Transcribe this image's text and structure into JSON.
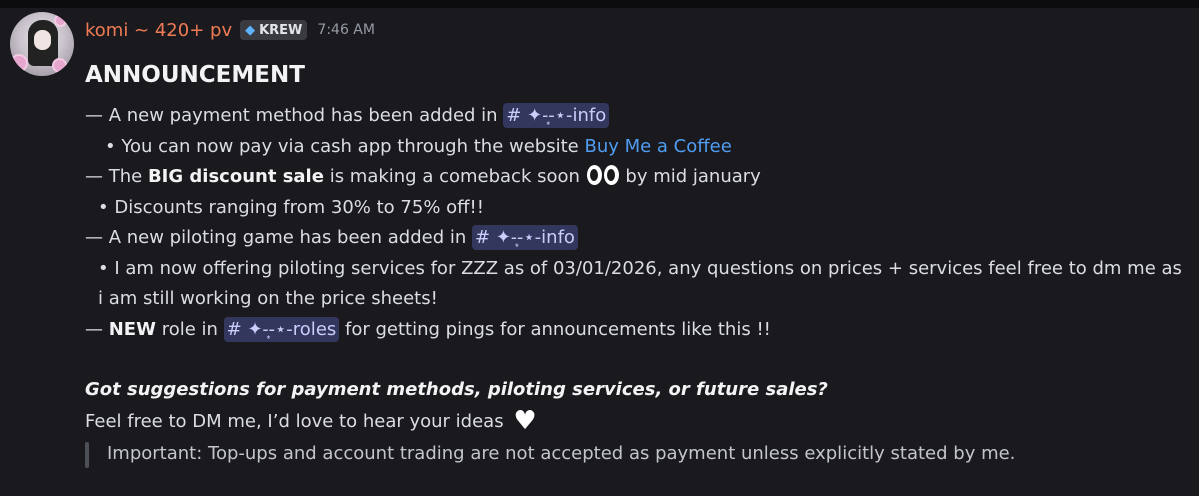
{
  "header": {
    "username": "komi ~ 420+ pv",
    "tag_icon": "gem-icon",
    "tag_label": "KREW",
    "timestamp": "7:46 AM"
  },
  "message": {
    "title": "ANNOUNCEMENT",
    "line1_text": "— A new payment method has been added in",
    "line1_channel": "# ✦-͙-⋆-info",
    "line2_text": "• You can now pay via cash app through the website",
    "line2_link": "Buy Me a Coffee",
    "line3_prefix": "— The",
    "line3_bold": "BIG discount sale",
    "line3_middle": "is making a comeback soon",
    "line3_suffix": "by mid january",
    "line4_text": "• Discounts ranging from 30% to 75% off!!",
    "line5_text": "— A new piloting game has been added in",
    "line5_channel": "# ✦-͙-⋆-info",
    "line6_text": "• I am now offering piloting services for ZZZ as of 03/01/2026, any questions on prices + services feel free to dm me as i am still working on the price sheets!",
    "line7_prefix": "—",
    "line7_bold": "NEW",
    "line7_middle": "role in",
    "line7_channel": "# ✦-͙-⋆-roles",
    "line7_suffix": "for getting pings for announcements like this !!",
    "question": "Got suggestions for payment methods, piloting services, or future sales?",
    "invite": "Feel free to DM me, I’d love to hear your ideas",
    "quote": "Important: Top-ups and account trading are not accepted as payment unless explicitly stated by me."
  },
  "colors": {
    "background": "#1a1a1e",
    "username": "#f07a54",
    "link": "#4f9df3",
    "mention_bg": "#34375d",
    "mention_text": "#c9cdfb"
  }
}
